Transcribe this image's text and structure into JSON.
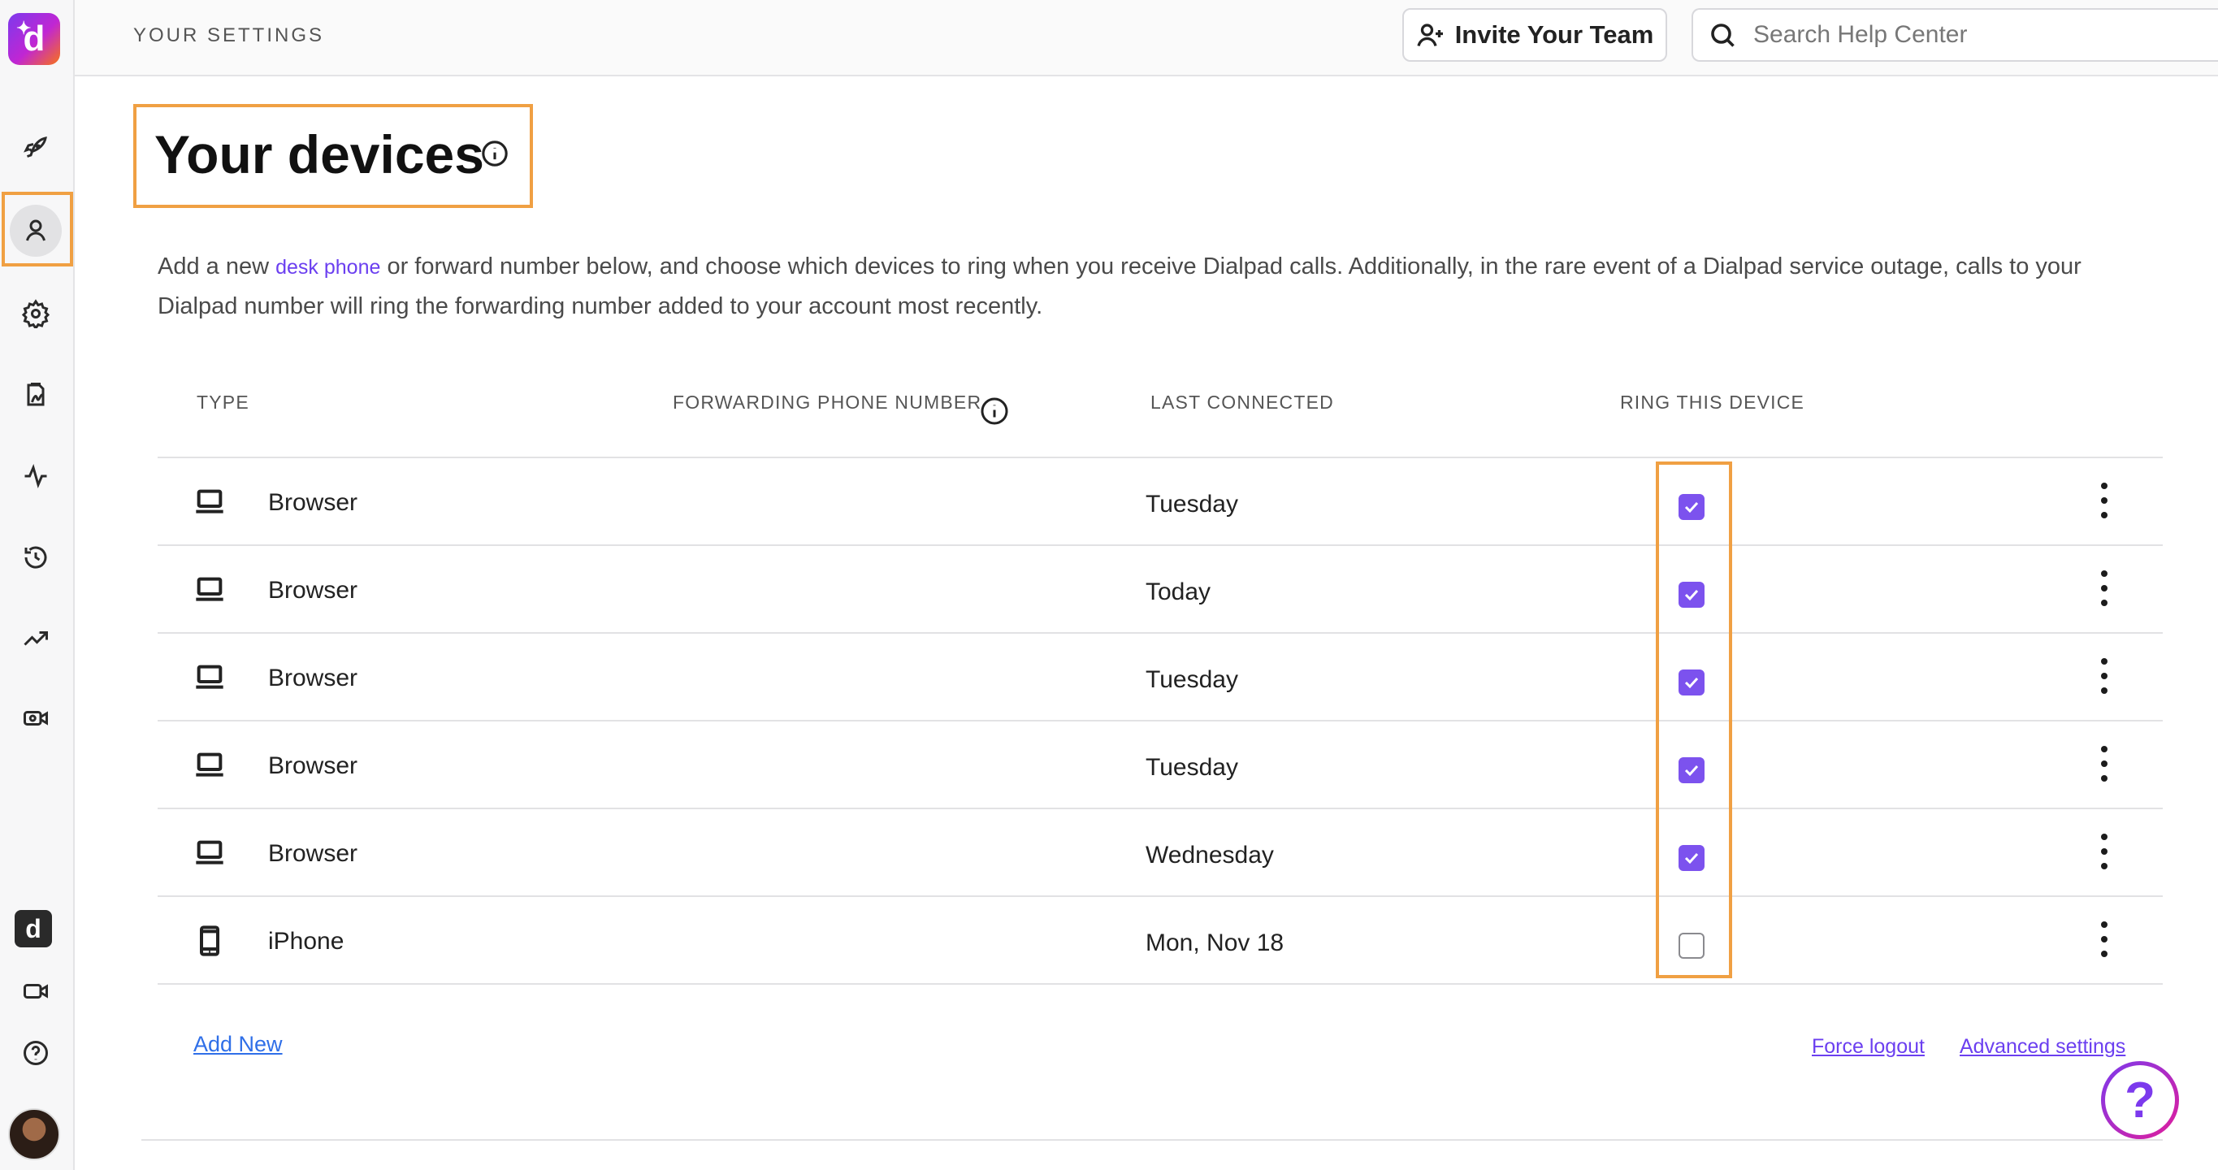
{
  "header": {
    "breadcrumb": "YOUR SETTINGS",
    "invite_label": "Invite Your Team",
    "search_placeholder": "Search Help Center"
  },
  "sidebar": {
    "logo": "d",
    "items": [
      {
        "name": "rocket-icon"
      },
      {
        "name": "person-icon",
        "active": true
      },
      {
        "name": "gear-icon"
      },
      {
        "name": "contacts-icon"
      },
      {
        "name": "activity-icon"
      },
      {
        "name": "history-icon"
      },
      {
        "name": "trending-icon"
      },
      {
        "name": "video-settings-icon"
      }
    ],
    "bottom_items": [
      {
        "name": "dialpad-ai-icon",
        "label": "d"
      },
      {
        "name": "video-icon"
      },
      {
        "name": "help-icon"
      },
      {
        "name": "avatar"
      }
    ]
  },
  "page": {
    "title": "Your devices",
    "description_before": "Add a new ",
    "description_link": "desk phone",
    "description_after": " or forward number below, and choose which devices to ring when you receive Dialpad calls. Additionally, in the rare event of a Dialpad service outage, calls to your Dialpad number will ring the forwarding number added to your account most recently."
  },
  "table": {
    "columns": {
      "type": "TYPE",
      "forwarding": "FORWARDING PHONE NUMBER",
      "last_connected": "LAST CONNECTED",
      "ring": "RING THIS DEVICE"
    },
    "rows": [
      {
        "type": "Browser",
        "icon": "laptop-icon",
        "last_connected": "Tuesday",
        "ring": true
      },
      {
        "type": "Browser",
        "icon": "laptop-icon",
        "last_connected": "Today",
        "ring": true
      },
      {
        "type": "Browser",
        "icon": "laptop-icon",
        "last_connected": "Tuesday",
        "ring": true
      },
      {
        "type": "Browser",
        "icon": "laptop-icon",
        "last_connected": "Tuesday",
        "ring": true
      },
      {
        "type": "Browser",
        "icon": "laptop-icon",
        "last_connected": "Wednesday",
        "ring": true
      },
      {
        "type": "iPhone",
        "icon": "phone-icon",
        "last_connected": "Mon, Nov 18",
        "ring": false
      }
    ]
  },
  "footer": {
    "add_new": "Add New",
    "force_logout": "Force logout",
    "advanced_settings": "Advanced settings",
    "help_fab": "?"
  },
  "colors": {
    "accent": "#7c52ee",
    "highlight": "#f0a043",
    "link": "#2f6fe8"
  }
}
